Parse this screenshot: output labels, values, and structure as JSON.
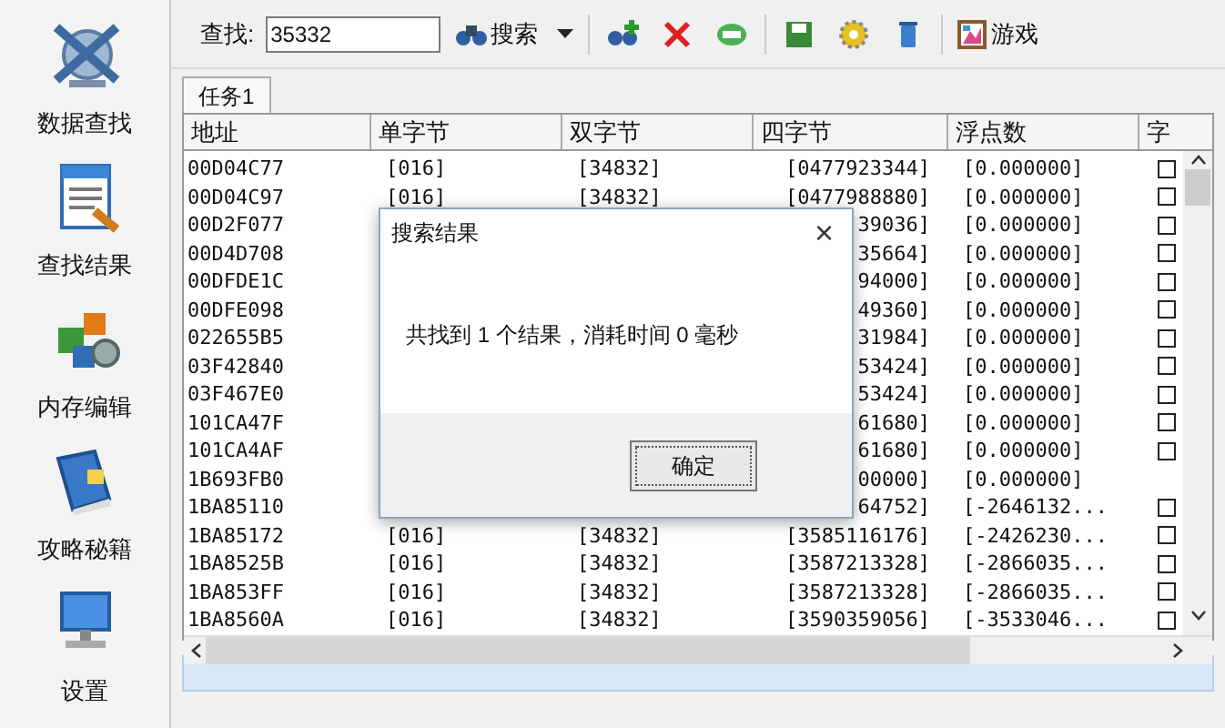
{
  "sidebar": {
    "items": [
      {
        "label": "数据查找",
        "kind": "search"
      },
      {
        "label": "查找结果",
        "kind": "results"
      },
      {
        "label": "内存编辑",
        "kind": "edit"
      },
      {
        "label": "攻略秘籍",
        "kind": "book"
      },
      {
        "label": "设置",
        "kind": "settings"
      }
    ]
  },
  "toolbar": {
    "search_label": "查找:",
    "search_value": "35332",
    "search_button": "搜索",
    "game_button": "游戏"
  },
  "tabs": [
    {
      "label": "任务1",
      "selected": true
    }
  ],
  "table": {
    "columns": [
      "地址",
      "单字节",
      "双字节",
      "四字节",
      "浮点数",
      "字"
    ],
    "rows": [
      {
        "address": "00D04C77",
        "single": "[016]",
        "double": "[34832]",
        "quad": "[0477923344]",
        "float": "[0.000000]",
        "checked": false
      },
      {
        "address": "00D04C97",
        "single": "[016]",
        "double": "[34832]",
        "quad": "[0477988880]",
        "float": "[0.000000]",
        "checked": false
      },
      {
        "address": "00D2F077",
        "quad": "39036]",
        "float": "[0.000000]",
        "checked": false
      },
      {
        "address": "00D4D708",
        "quad": "35664]",
        "float": "[0.000000]",
        "checked": false
      },
      {
        "address": "00DFDE1C",
        "quad": "94000]",
        "float": "[0.000000]",
        "checked": false
      },
      {
        "address": "00DFE098",
        "quad": "49360]",
        "float": "[0.000000]",
        "checked": false
      },
      {
        "address": "022655B5",
        "quad": "31984]",
        "float": "[0.000000]",
        "checked": false
      },
      {
        "address": "03F42840",
        "quad": "53424]",
        "float": "[0.000000]",
        "checked": false
      },
      {
        "address": "03F467E0",
        "quad": "53424]",
        "float": "[0.000000]",
        "checked": false
      },
      {
        "address": "101CA47F",
        "quad": "61680]",
        "float": "[0.000000]",
        "checked": false
      },
      {
        "address": "101CA4AF",
        "quad": "61680]",
        "float": "[0.000000]",
        "checked": false
      },
      {
        "address": "1B693FB0",
        "quad": "00000]",
        "float": "[0.000000]"
      },
      {
        "address": "1BA85110",
        "quad": "64752]",
        "float": "[-2646132...",
        "checked": false
      },
      {
        "address": "1BA85172",
        "single": "[016]",
        "double": "[34832]",
        "quad": "[3585116176]",
        "float": "[-2426230...",
        "checked": false
      },
      {
        "address": "1BA8525B",
        "single": "[016]",
        "double": "[34832]",
        "quad": "[3587213328]",
        "float": "[-2866035...",
        "checked": false
      },
      {
        "address": "1BA853FF",
        "single": "[016]",
        "double": "[34832]",
        "quad": "[3587213328]",
        "float": "[-2866035...",
        "checked": false
      },
      {
        "address": "1BA8560A",
        "single": "[016]",
        "double": "[34832]",
        "quad": "[3590359056]",
        "float": "[-3533046...",
        "checked": false
      }
    ]
  },
  "dialog": {
    "title": "搜索结果",
    "close": "×",
    "message": "共找到 1 个结果，消耗时间 0 毫秒",
    "ok_button": "确定"
  }
}
